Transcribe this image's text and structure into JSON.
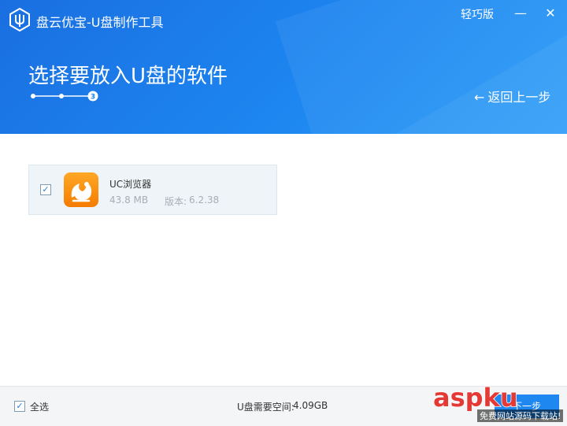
{
  "window": {
    "title": "盘云优宝-U盘制作工具",
    "lite_mode_label": "轻巧版",
    "minimize_symbol": "—",
    "close_symbol": "✕"
  },
  "header": {
    "page_title": "选择要放入U盘的软件",
    "current_step": "3",
    "back_label": "返回上一步"
  },
  "software_list": [
    {
      "name": "UC浏览器",
      "size": "43.8 MB",
      "version_label": "版本:",
      "version": "6.2.38",
      "checked": true,
      "icon": "uc-browser-icon"
    }
  ],
  "footer": {
    "select_all_label": "全选",
    "space_label": "U盘需要空间:",
    "space_value": "4.09GB",
    "next_button_label": "下一步"
  },
  "watermark": {
    "text": "aspku",
    "subtext": "免费网站源码下载站!"
  },
  "colors": {
    "header_blue": "#1d86f0",
    "accent": "#1e87f0",
    "icon_orange": "#f57c00"
  }
}
